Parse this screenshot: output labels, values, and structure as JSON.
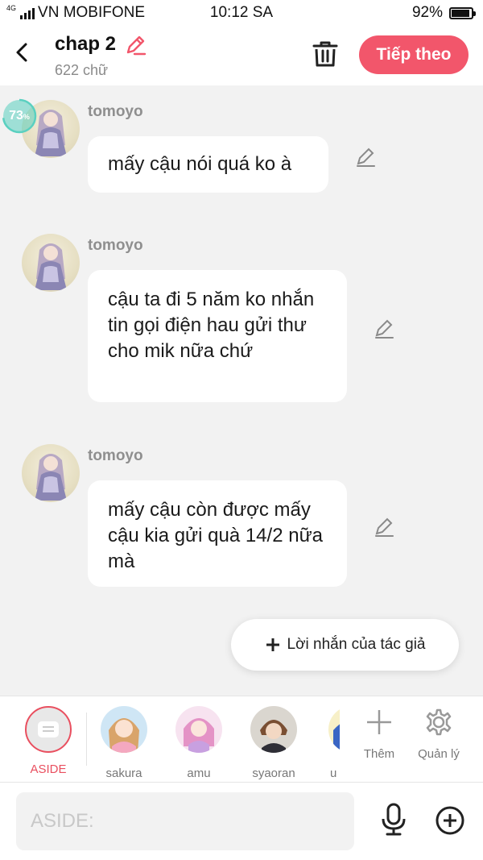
{
  "status_bar": {
    "network": "4G",
    "carrier": "VN MOBIFONE",
    "time": "10:12 SA",
    "battery": "92%",
    "battery_level": 0.92
  },
  "header": {
    "title": "chap 2",
    "word_count": "622 chữ",
    "next_label": "Tiếp theo"
  },
  "progress": {
    "value": "73",
    "unit": "%",
    "fraction": 0.73
  },
  "messages": [
    {
      "sender": "tomoyo",
      "text": "mấy cậu nói quá ko à"
    },
    {
      "sender": "tomoyo",
      "text": "cậu ta đi 5 năm ko nhắn tin gọi điện hau gửi thư cho mik nữa chứ"
    },
    {
      "sender": "tomoyo",
      "text": "mấy cậu còn được mấy cậu kia gửi quà 14/2 nữa mà"
    }
  ],
  "author_note_label": "Lời nhắn của tác giả",
  "characters": [
    {
      "name": "ASIDE"
    },
    {
      "name": "sakura"
    },
    {
      "name": "amu"
    },
    {
      "name": "syaoran"
    },
    {
      "name": "u"
    }
  ],
  "tools": {
    "add_label": "Thêm",
    "manage_label": "Quản lý"
  },
  "input": {
    "placeholder": "ASIDE:"
  },
  "colors": {
    "accent": "#f2566b",
    "progress": "#5ad0c0"
  }
}
